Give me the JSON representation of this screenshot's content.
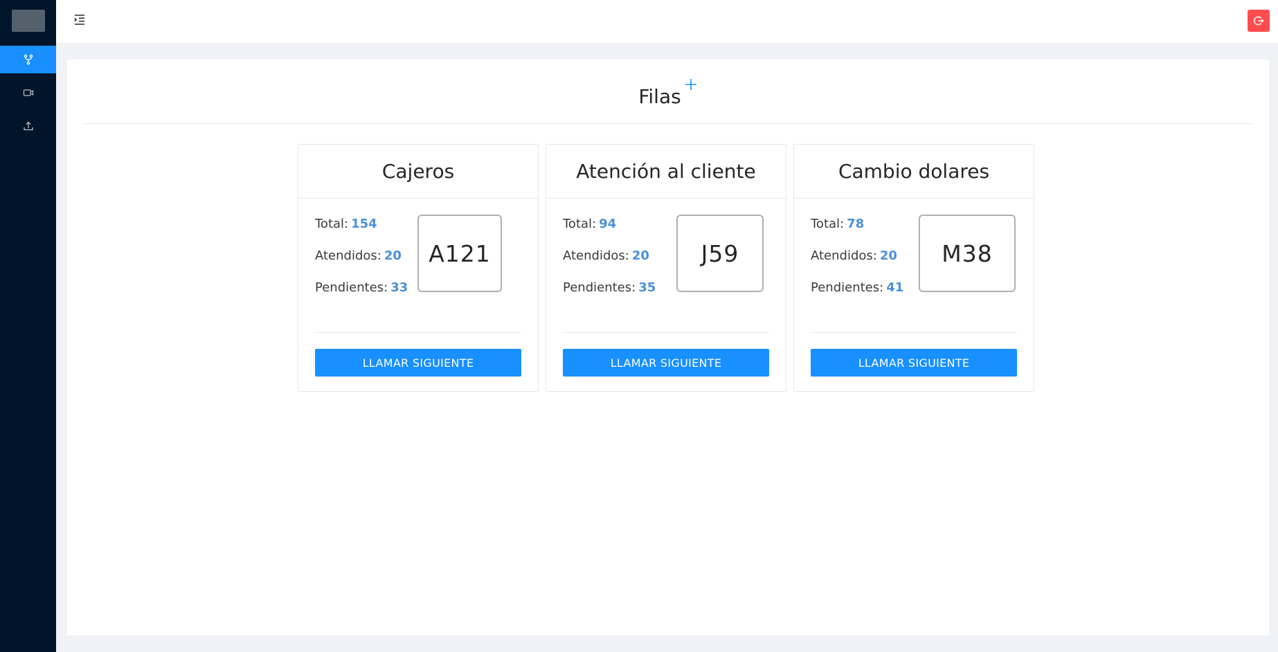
{
  "colors": {
    "sidebar_bg": "#001529",
    "primary": "#1890ff",
    "danger": "#ff4d4f",
    "stat_number": "#4a90d9",
    "page_bg": "#f0f2f5"
  },
  "sidebar": {
    "items": [
      {
        "icon": "fork-icon",
        "active": true
      },
      {
        "icon": "video-camera-icon",
        "active": false
      },
      {
        "icon": "upload-icon",
        "active": false
      }
    ]
  },
  "header": {
    "fold_icon": "menu-fold-icon",
    "logout_icon": "logout-icon"
  },
  "page": {
    "title": "Filas",
    "add_icon": "plus-icon"
  },
  "queues": [
    {
      "name": "Cajeros",
      "total_label": "Total:",
      "total": "154",
      "attended_label": "Atendidos:",
      "attended": "20",
      "pending_label": "Pendientes:",
      "pending": "33",
      "current_ticket": "A121",
      "button_label": "LLAMAR SIGUIENTE"
    },
    {
      "name": "Atención al cliente",
      "total_label": "Total:",
      "total": "94",
      "attended_label": "Atendidos:",
      "attended": "20",
      "pending_label": "Pendientes:",
      "pending": "35",
      "current_ticket": "J59",
      "button_label": "LLAMAR SIGUIENTE"
    },
    {
      "name": "Cambio dolares",
      "total_label": "Total:",
      "total": "78",
      "attended_label": "Atendidos:",
      "attended": "20",
      "pending_label": "Pendientes:",
      "pending": "41",
      "current_ticket": "M38",
      "button_label": "LLAMAR SIGUIENTE"
    }
  ]
}
